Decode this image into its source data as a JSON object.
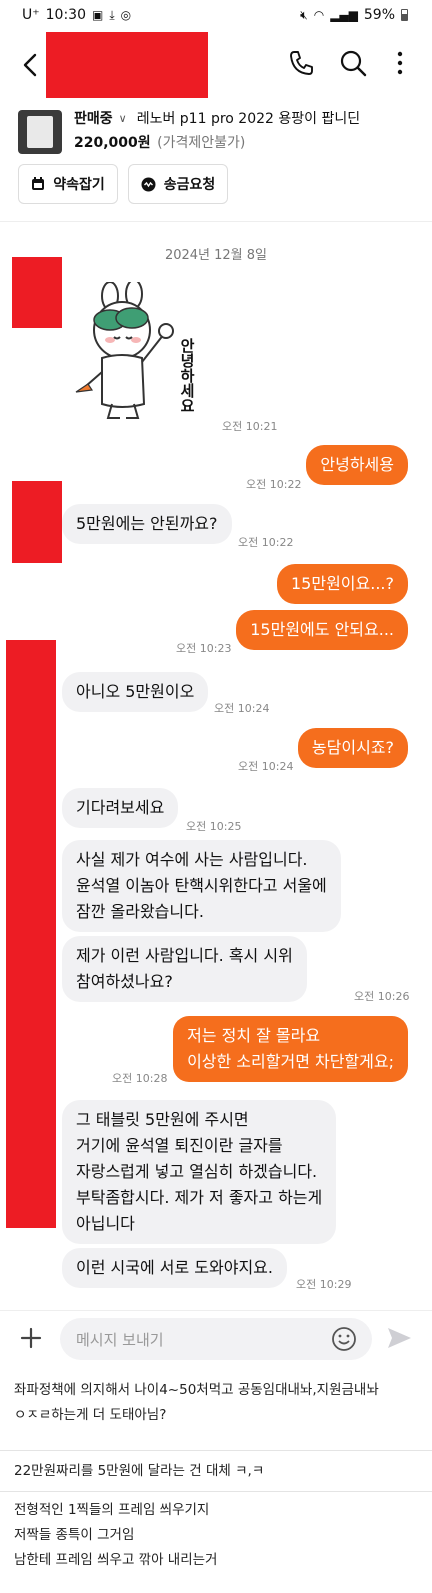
{
  "status_bar": {
    "carrier": "U⁺",
    "time": "10:30",
    "battery": "59%"
  },
  "header": {
    "back_icon": "chevron-left-icon",
    "call_icon": "phone-icon",
    "search_icon": "search-icon",
    "more_icon": "more-vertical-icon"
  },
  "product": {
    "sale_status": "판매중",
    "title": "레노버 p11 pro 2022 용팡이 팝니딘",
    "price": "220,000원",
    "price_note": "(가격제안불가)",
    "appointment_label": "약속잡기",
    "payment_request_label": "송금요청"
  },
  "chat": {
    "date": "2024년 12월 8일",
    "sticker_text": "안녕하세요",
    "messages": [
      {
        "side": "in",
        "kind": "sticker",
        "time": "오전 10:21"
      },
      {
        "side": "out",
        "text": "안녕하세용",
        "time": "오전 10:22"
      },
      {
        "side": "in",
        "text": "5만원에는 안된까요?",
        "time": "오전 10:22"
      },
      {
        "side": "out",
        "text": "15만원이요...?",
        "time": ""
      },
      {
        "side": "out",
        "text": "15만원에도 안되요...",
        "time": "오전 10:23"
      },
      {
        "side": "in",
        "text": "아니오 5만원이오",
        "time": "오전 10:24"
      },
      {
        "side": "out",
        "text": "농담이시죠?",
        "time": "오전 10:24"
      },
      {
        "side": "in",
        "text": "기다려보세요",
        "time": "오전 10:25"
      },
      {
        "side": "in",
        "lines": [
          "사실 제가 여수에 사는 사람입니다.",
          "윤석열 이놈아 탄핵시위한다고 서울에",
          "잠깐 올라왔습니다."
        ],
        "time": ""
      },
      {
        "side": "in",
        "lines": [
          "제가 이런 사람입니다. 혹시 시위",
          "참여하셨나요?"
        ],
        "time": "오전 10:26"
      },
      {
        "side": "out",
        "lines": [
          "저는 정치 잘 몰라요",
          "이상한 소리할거면 차단할게요;"
        ],
        "time": "오전 10:28"
      },
      {
        "side": "in",
        "lines": [
          "그 태블릿 5만원에 주시면",
          "거기에 윤석열 퇴진이란 글자를",
          "자랑스럽게 넣고 열심히 하겠습니다.",
          "부탁좀합시다. 제가 저 좋자고 하는게",
          "아닙니다"
        ],
        "time": ""
      },
      {
        "side": "in",
        "text": "이런 시국에 서로 도와야지요.",
        "time": "오전 10:29"
      }
    ]
  },
  "input": {
    "placeholder": "메시지 보내기"
  },
  "comments": [
    {
      "lines": [
        "좌파정책에 의지해서 나이4~50처먹고 공동임대내놔,지원금내놔",
        "ㅇㅈㄹ하는게 더 도태아님?"
      ]
    },
    {
      "lines": [
        "22만원짜리를 5만원에 달라는 건 대체 ㅋ,ㅋ"
      ]
    },
    {
      "lines": [
        "전형적인 1찍들의 프레임 씌우기지",
        "저짝들 종특이 그거임",
        "남한테 프레임 씌우고 깎아 내리는거"
      ]
    }
  ],
  "colors": {
    "accent": "#f56e1d",
    "redaction": "#ed1c24",
    "bubble_in": "#f1f1f3"
  }
}
